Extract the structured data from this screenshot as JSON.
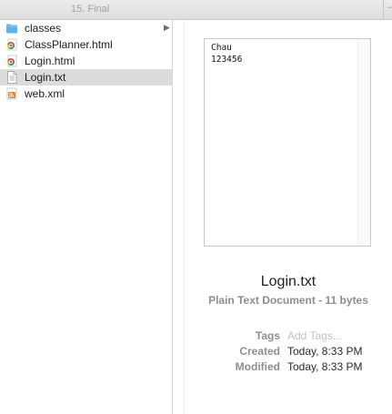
{
  "window": {
    "title": "15. Final"
  },
  "files": [
    {
      "name": "classes",
      "icon": "folder-icon",
      "has_children": true,
      "selected": false
    },
    {
      "name": "ClassPlanner.html",
      "icon": "chrome-html-icon",
      "has_children": false,
      "selected": false
    },
    {
      "name": "Login.html",
      "icon": "chrome-html-icon",
      "has_children": false,
      "selected": false
    },
    {
      "name": "Login.txt",
      "icon": "text-document-icon",
      "has_children": false,
      "selected": true
    },
    {
      "name": "web.xml",
      "icon": "xml-feed-icon",
      "has_children": false,
      "selected": false
    }
  ],
  "preview": {
    "content_lines": [
      "Chau",
      "123456"
    ],
    "file_name": "Login.txt",
    "kind": "Plain Text Document - 11 bytes",
    "tags_label": "Tags",
    "tags_placeholder": "Add Tags...",
    "created_label": "Created",
    "created_value": "Today, 8:33 PM",
    "modified_label": "Modified",
    "modified_value": "Today, 8:33 PM"
  },
  "colors": {
    "folder": "#5ab4f0",
    "selection": "#dcdcdc",
    "xml": "#e8822a"
  }
}
